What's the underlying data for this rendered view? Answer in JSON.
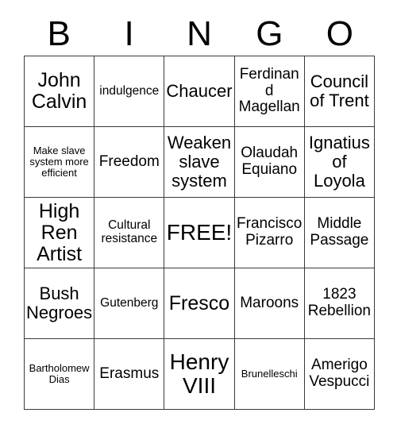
{
  "card": {
    "title": "BINGO",
    "header": {
      "letters": [
        "B",
        "I",
        "N",
        "G",
        "O"
      ]
    },
    "colors": {
      "background": "#ffffff",
      "text": "#000000",
      "border": "#3a3a3a"
    },
    "grid": {
      "columns": 5,
      "rows": 5,
      "free_space_label": "FREE!",
      "free_space_position": "center",
      "rows_data": [
        [
          {
            "text": "John Calvin",
            "size": "xl"
          },
          {
            "text": "indulgence",
            "size": "sm"
          },
          {
            "text": "Chaucer",
            "size": "lg"
          },
          {
            "text": "Ferdinand Magellan",
            "size": "md"
          },
          {
            "text": "Council of Trent",
            "size": "lg"
          }
        ],
        [
          {
            "text": "Make slave system more efficient",
            "size": "xs"
          },
          {
            "text": "Freedom",
            "size": "md"
          },
          {
            "text": "Weaken slave system",
            "size": "lg"
          },
          {
            "text": "Olaudah Equiano",
            "size": "md"
          },
          {
            "text": "Ignatius of Loyola",
            "size": "lg"
          }
        ],
        [
          {
            "text": "High Ren Artist",
            "size": "xl"
          },
          {
            "text": "Cultural resistance",
            "size": "sm"
          },
          {
            "text": "FREE!",
            "size": "xxl"
          },
          {
            "text": "Francisco Pizarro",
            "size": "md"
          },
          {
            "text": "Middle Passage",
            "size": "md"
          }
        ],
        [
          {
            "text": "Bush Negroes",
            "size": "lg"
          },
          {
            "text": "Gutenberg",
            "size": "sm"
          },
          {
            "text": "Fresco",
            "size": "xl"
          },
          {
            "text": "Maroons",
            "size": "md"
          },
          {
            "text": "1823 Rebellion",
            "size": "md"
          }
        ],
        [
          {
            "text": "Bartholomew Dias",
            "size": "xs"
          },
          {
            "text": "Erasmus",
            "size": "md"
          },
          {
            "text": "Henry VIII",
            "size": "xxl"
          },
          {
            "text": "Brunelleschi",
            "size": "xs"
          },
          {
            "text": "Amerigo Vespucci",
            "size": "md"
          }
        ]
      ]
    }
  }
}
